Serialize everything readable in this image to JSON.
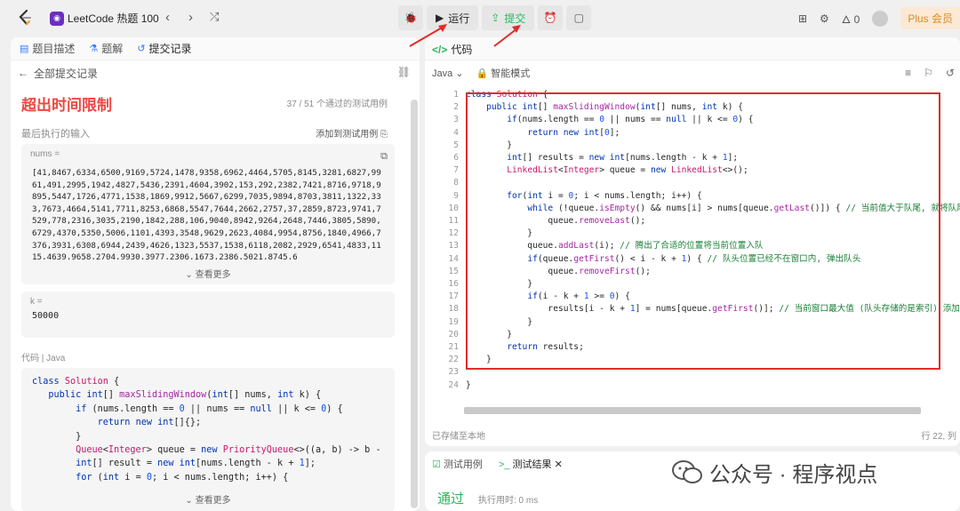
{
  "topbar": {
    "brand": "LeetCode 热题 100",
    "run_label": "运行",
    "submit_label": "提交",
    "points": "0",
    "plus_label": "Plus 会员"
  },
  "left": {
    "tabs": [
      "题目描述",
      "题解",
      "提交记录"
    ],
    "back_label": "全部提交记录",
    "result_title": "超出时间限制",
    "result_count": "37 / 51  个通过的测试用例",
    "last_input_label": "最后执行的输入",
    "add_case_label": "添加到测试用例",
    "nums_label": "nums =",
    "nums_value": "[41,8467,6334,6500,9169,5724,1478,9358,6962,4464,5705,8145,3281,6827,9961,491,2995,1942,4827,5436,2391,4604,3902,153,292,2382,7421,8716,9718,9895,5447,1726,4771,1538,1869,9912,5667,6299,7035,9894,8703,3811,1322,333,7673,4664,5141,7711,8253,6868,5547,7644,2662,2757,37,2859,8723,9741,7529,778,2316,3035,2190,1842,288,106,9040,8942,9264,2648,7446,3805,5890,6729,4370,5350,5006,1101,4393,3548,9629,2623,4084,9954,8756,1840,4966,7376,3931,6308,6944,2439,4626,1323,5537,1538,6118,2082,2929,6541,4833,1115,4639,9658,2704,9930,3977,2306,1673,2386,5021,8745,6",
    "view_more": "查看更多",
    "k_label": "k =",
    "k_value": "50000",
    "code_label": "代码",
    "code_lang": "Java",
    "view_more_2": "查看更多"
  },
  "right": {
    "tab_label": "代码",
    "lang": "Java",
    "mode": "智能模式",
    "saved": "已存储至本地",
    "cursor": "行 22, 列"
  },
  "bottom": {
    "tab_cases": "测试用例",
    "tab_result": "测试结果",
    "pass": "通过",
    "runtime": "执行用时: 0 ms"
  },
  "watermark": "公众号 · 程序视点",
  "colors": {
    "accent_green": "#2db55d",
    "error_red": "#ef4743",
    "annot_red": "#e12b2b"
  }
}
